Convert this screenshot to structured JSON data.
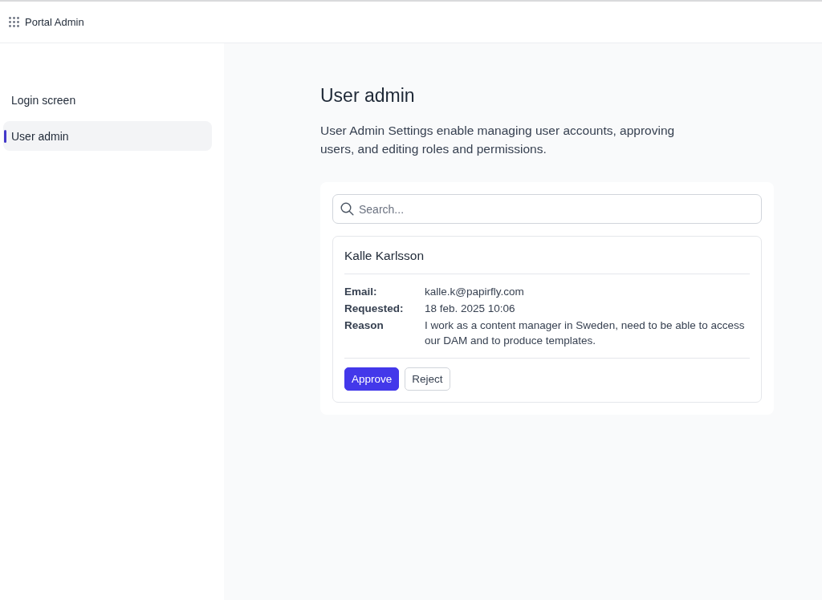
{
  "header": {
    "title": "Portal Admin"
  },
  "sidebar": {
    "items": [
      {
        "label": "Login screen",
        "selected": false
      },
      {
        "label": "User admin",
        "selected": true
      }
    ]
  },
  "page": {
    "title": "User admin",
    "description": "User Admin Settings enable managing user accounts, approving users, and editing roles and permissions."
  },
  "search": {
    "placeholder": "Search..."
  },
  "requests": [
    {
      "name": "Kalle Karlsson",
      "fields": [
        {
          "label": "Email:",
          "value": "kalle.k@papirfly.com"
        },
        {
          "label": "Requested:",
          "value": "18 feb. 2025 10:06"
        },
        {
          "label": "Reason",
          "value": "I work as a content manager in Sweden, need to be able to access our DAM and to produce templates."
        }
      ],
      "buttons": [
        {
          "label": "Approve",
          "kind": "primary"
        },
        {
          "label": "Reject",
          "kind": "secondary"
        }
      ]
    }
  ]
}
